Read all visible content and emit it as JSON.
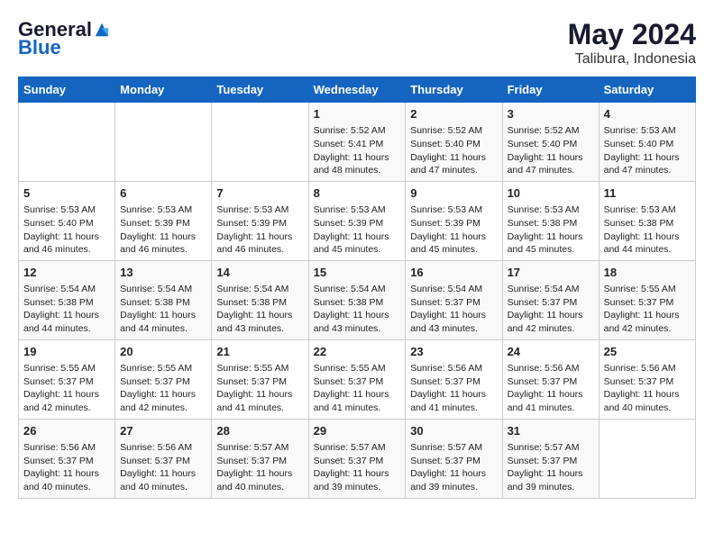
{
  "logo": {
    "general": "General",
    "blue": "Blue"
  },
  "title": "May 2024",
  "subtitle": "Talibura, Indonesia",
  "days_header": [
    "Sunday",
    "Monday",
    "Tuesday",
    "Wednesday",
    "Thursday",
    "Friday",
    "Saturday"
  ],
  "weeks": [
    [
      {
        "day": "",
        "info": ""
      },
      {
        "day": "",
        "info": ""
      },
      {
        "day": "",
        "info": ""
      },
      {
        "day": "1",
        "info": "Sunrise: 5:52 AM\nSunset: 5:41 PM\nDaylight: 11 hours\nand 48 minutes."
      },
      {
        "day": "2",
        "info": "Sunrise: 5:52 AM\nSunset: 5:40 PM\nDaylight: 11 hours\nand 47 minutes."
      },
      {
        "day": "3",
        "info": "Sunrise: 5:52 AM\nSunset: 5:40 PM\nDaylight: 11 hours\nand 47 minutes."
      },
      {
        "day": "4",
        "info": "Sunrise: 5:53 AM\nSunset: 5:40 PM\nDaylight: 11 hours\nand 47 minutes."
      }
    ],
    [
      {
        "day": "5",
        "info": "Sunrise: 5:53 AM\nSunset: 5:40 PM\nDaylight: 11 hours\nand 46 minutes."
      },
      {
        "day": "6",
        "info": "Sunrise: 5:53 AM\nSunset: 5:39 PM\nDaylight: 11 hours\nand 46 minutes."
      },
      {
        "day": "7",
        "info": "Sunrise: 5:53 AM\nSunset: 5:39 PM\nDaylight: 11 hours\nand 46 minutes."
      },
      {
        "day": "8",
        "info": "Sunrise: 5:53 AM\nSunset: 5:39 PM\nDaylight: 11 hours\nand 45 minutes."
      },
      {
        "day": "9",
        "info": "Sunrise: 5:53 AM\nSunset: 5:39 PM\nDaylight: 11 hours\nand 45 minutes."
      },
      {
        "day": "10",
        "info": "Sunrise: 5:53 AM\nSunset: 5:38 PM\nDaylight: 11 hours\nand 45 minutes."
      },
      {
        "day": "11",
        "info": "Sunrise: 5:53 AM\nSunset: 5:38 PM\nDaylight: 11 hours\nand 44 minutes."
      }
    ],
    [
      {
        "day": "12",
        "info": "Sunrise: 5:54 AM\nSunset: 5:38 PM\nDaylight: 11 hours\nand 44 minutes."
      },
      {
        "day": "13",
        "info": "Sunrise: 5:54 AM\nSunset: 5:38 PM\nDaylight: 11 hours\nand 44 minutes."
      },
      {
        "day": "14",
        "info": "Sunrise: 5:54 AM\nSunset: 5:38 PM\nDaylight: 11 hours\nand 43 minutes."
      },
      {
        "day": "15",
        "info": "Sunrise: 5:54 AM\nSunset: 5:38 PM\nDaylight: 11 hours\nand 43 minutes."
      },
      {
        "day": "16",
        "info": "Sunrise: 5:54 AM\nSunset: 5:37 PM\nDaylight: 11 hours\nand 43 minutes."
      },
      {
        "day": "17",
        "info": "Sunrise: 5:54 AM\nSunset: 5:37 PM\nDaylight: 11 hours\nand 42 minutes."
      },
      {
        "day": "18",
        "info": "Sunrise: 5:55 AM\nSunset: 5:37 PM\nDaylight: 11 hours\nand 42 minutes."
      }
    ],
    [
      {
        "day": "19",
        "info": "Sunrise: 5:55 AM\nSunset: 5:37 PM\nDaylight: 11 hours\nand 42 minutes."
      },
      {
        "day": "20",
        "info": "Sunrise: 5:55 AM\nSunset: 5:37 PM\nDaylight: 11 hours\nand 42 minutes."
      },
      {
        "day": "21",
        "info": "Sunrise: 5:55 AM\nSunset: 5:37 PM\nDaylight: 11 hours\nand 41 minutes."
      },
      {
        "day": "22",
        "info": "Sunrise: 5:55 AM\nSunset: 5:37 PM\nDaylight: 11 hours\nand 41 minutes."
      },
      {
        "day": "23",
        "info": "Sunrise: 5:56 AM\nSunset: 5:37 PM\nDaylight: 11 hours\nand 41 minutes."
      },
      {
        "day": "24",
        "info": "Sunrise: 5:56 AM\nSunset: 5:37 PM\nDaylight: 11 hours\nand 41 minutes."
      },
      {
        "day": "25",
        "info": "Sunrise: 5:56 AM\nSunset: 5:37 PM\nDaylight: 11 hours\nand 40 minutes."
      }
    ],
    [
      {
        "day": "26",
        "info": "Sunrise: 5:56 AM\nSunset: 5:37 PM\nDaylight: 11 hours\nand 40 minutes."
      },
      {
        "day": "27",
        "info": "Sunrise: 5:56 AM\nSunset: 5:37 PM\nDaylight: 11 hours\nand 40 minutes."
      },
      {
        "day": "28",
        "info": "Sunrise: 5:57 AM\nSunset: 5:37 PM\nDaylight: 11 hours\nand 40 minutes."
      },
      {
        "day": "29",
        "info": "Sunrise: 5:57 AM\nSunset: 5:37 PM\nDaylight: 11 hours\nand 39 minutes."
      },
      {
        "day": "30",
        "info": "Sunrise: 5:57 AM\nSunset: 5:37 PM\nDaylight: 11 hours\nand 39 minutes."
      },
      {
        "day": "31",
        "info": "Sunrise: 5:57 AM\nSunset: 5:37 PM\nDaylight: 11 hours\nand 39 minutes."
      },
      {
        "day": "",
        "info": ""
      }
    ]
  ]
}
